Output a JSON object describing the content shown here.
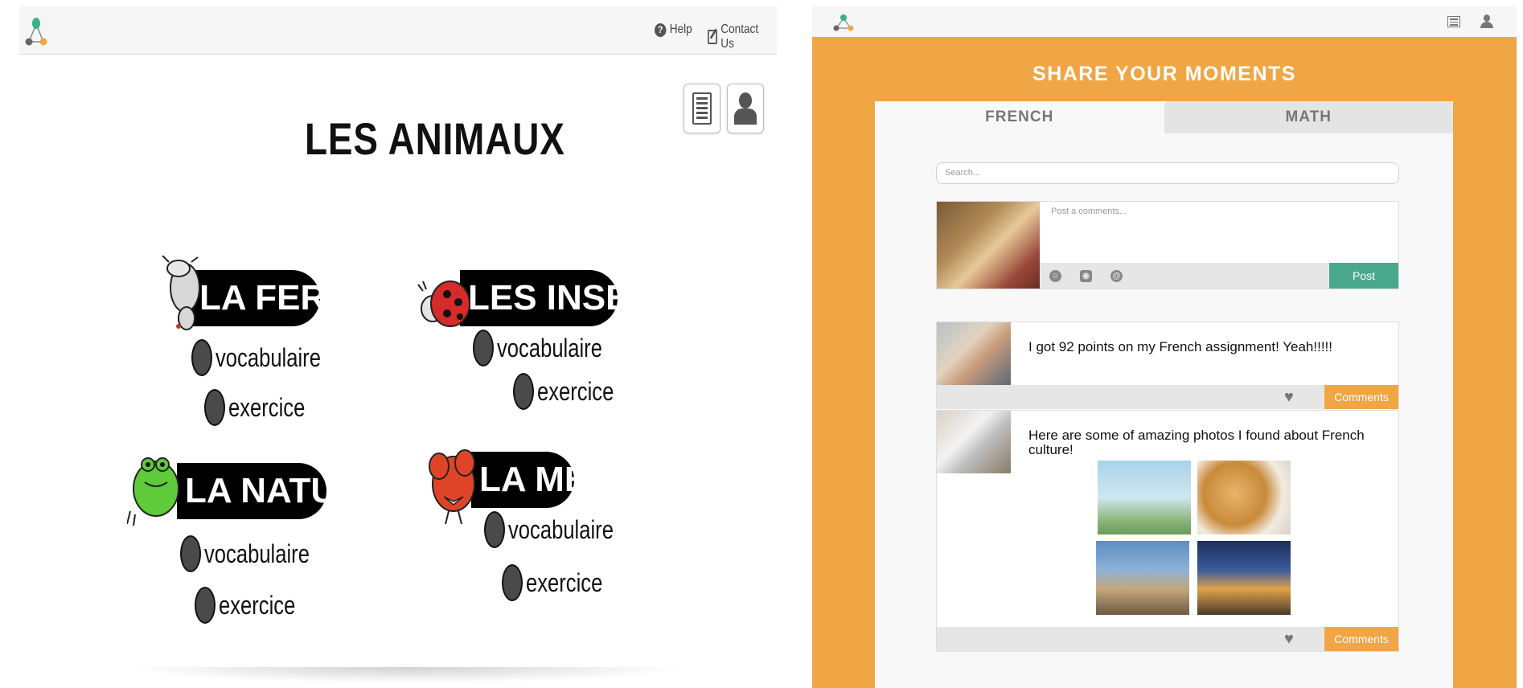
{
  "left": {
    "nav": {
      "help": "Help",
      "contact": "Contact Us"
    },
    "title": "LES ANIMAUX",
    "categories": [
      {
        "banner": "LA FERME",
        "vocab": "vocabulaire",
        "exercise": "exercice",
        "mascot": "cow-icon"
      },
      {
        "banner": "LES INSECTES",
        "vocab": "vocabulaire",
        "exercise": "exercice",
        "mascot": "ladybug-icon"
      },
      {
        "banner": "LA NATURE",
        "vocab": "vocabulaire",
        "exercise": "exercice",
        "mascot": "frog-icon"
      },
      {
        "banner": "LA MER",
        "vocab": "vocabulaire",
        "exercise": "exercice",
        "mascot": "lobster-icon"
      }
    ]
  },
  "right": {
    "title": "SHARE YOUR MOMENTS",
    "tabs": [
      "FRENCH",
      "MATH"
    ],
    "search_placeholder": "Search...",
    "composer": {
      "placeholder": "Post a comments...",
      "post_label": "Post"
    },
    "posts": [
      {
        "text": "I got 92 points on my French assignment! Yeah!!!!!",
        "comments_label": "Comments"
      },
      {
        "text": "Here are some of amazing photos I found about French culture!",
        "comments_label": "Comments"
      }
    ]
  },
  "colors": {
    "accent_orange": "#f0a645",
    "post_green": "#4aa88c",
    "banner_black": "#000000"
  }
}
